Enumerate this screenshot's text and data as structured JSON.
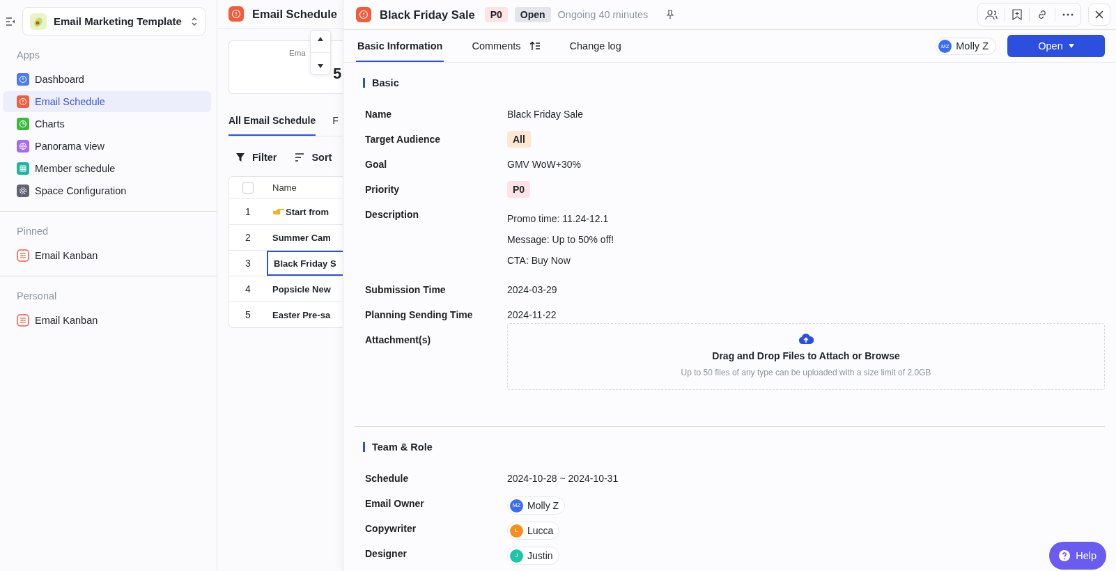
{
  "sidebar": {
    "workspace": "Email Marketing Template",
    "sections": [
      {
        "title": "Apps",
        "items": [
          {
            "label": "Dashboard",
            "kind": "info",
            "color": "#4b7bf5",
            "selected": false
          },
          {
            "label": "Email Schedule",
            "kind": "info",
            "color": "#f25c3c",
            "selected": true
          },
          {
            "label": "Charts",
            "kind": "chart",
            "color": "#3cb93c",
            "selected": false
          },
          {
            "label": "Panorama view",
            "kind": "globe",
            "color": "#a56cf0",
            "selected": false
          },
          {
            "label": "Member schedule",
            "kind": "grid",
            "color": "#1fb5a0",
            "selected": false
          },
          {
            "label": "Space Configuration",
            "kind": "gear",
            "color": "#5f6270",
            "selected": false
          }
        ]
      },
      {
        "title": "Pinned",
        "items": [
          {
            "label": "Email Kanban",
            "kind": "list",
            "color": "#f4816b",
            "selected": false
          }
        ]
      },
      {
        "title": "Personal",
        "items": [
          {
            "label": "Email Kanban",
            "kind": "list",
            "color": "#f4816b",
            "selected": false
          }
        ]
      }
    ]
  },
  "view": {
    "title": "Email Schedule",
    "card": {
      "label": "Ema",
      "value": "5"
    },
    "tabs": [
      {
        "label": "All Email Schedule",
        "selected": true
      },
      {
        "label": "F",
        "selected": false
      }
    ],
    "toolbar": [
      {
        "label": "Filter",
        "kind": "filter"
      },
      {
        "label": "Sort",
        "kind": "sort"
      }
    ],
    "table": {
      "columns": [
        "Name"
      ],
      "all_checked": false,
      "rows": [
        {
          "number": "1",
          "name": "Start from",
          "pointer": true,
          "selected": false
        },
        {
          "number": "2",
          "name": "Summer Cam",
          "pointer": false,
          "selected": false
        },
        {
          "number": "3",
          "name": "Black Friday S",
          "pointer": false,
          "selected": true
        },
        {
          "number": "4",
          "name": "Popsicle New",
          "pointer": false,
          "selected": false
        },
        {
          "number": "5",
          "name": "Easter Pre-sa",
          "pointer": false,
          "selected": false
        }
      ]
    }
  },
  "record": {
    "title": "Black Friday Sale",
    "tags": [
      {
        "label": "P0",
        "color": "#fde3e6"
      },
      {
        "label": "Open",
        "color": "#e3e5ea"
      }
    ],
    "status_text": "Ongoing 40 minutes",
    "tabs": [
      {
        "label": "Basic Information",
        "selected": true,
        "sort_icon": false
      },
      {
        "label": "Comments",
        "selected": false,
        "sort_icon": true
      },
      {
        "label": "Change log",
        "selected": false,
        "sort_icon": false
      }
    ],
    "assignee": {
      "initials": "MZ",
      "name": "Molly Z",
      "color": "#3b6cf6"
    },
    "status_button": "Open",
    "sections": [
      {
        "title": "Basic",
        "fields": [
          {
            "label": "Name",
            "kind": "text",
            "value": "Black Friday Sale"
          },
          {
            "label": "Target Audience",
            "kind": "tag",
            "value": "All",
            "color": "#fde7cf"
          },
          {
            "label": "Goal",
            "kind": "text",
            "value": "GMV WoW+30%"
          },
          {
            "label": "Priority",
            "kind": "tag",
            "value": "P0",
            "color": "#fde3e6"
          },
          {
            "label": "Description",
            "kind": "lines",
            "lines": [
              "Promo time: 11.24-12.1",
              "Message: Up to 50% off!",
              "CTA: Buy Now"
            ]
          },
          {
            "label": "Submission Time",
            "kind": "text",
            "value": "2024-03-29"
          },
          {
            "label": "Planning Sending Time",
            "kind": "text",
            "value": "2024-11-22"
          },
          {
            "label": "Attachment(s)",
            "kind": "upload",
            "title": "Drag and Drop Files to Attach or Browse",
            "hint": "Up to 50 files of any type can be uploaded with a size limit of 2.0GB"
          }
        ]
      },
      {
        "title": "Team & Role",
        "fields": [
          {
            "label": "Schedule",
            "kind": "text",
            "value": "2024-10-28 ~ 2024-10-31"
          },
          {
            "label": "Email Owner",
            "kind": "person",
            "initials": "MZ",
            "value": "Molly Z",
            "color": "#3b6cf6"
          },
          {
            "label": "Copywriter",
            "kind": "person",
            "initials": "L",
            "value": "Lucca",
            "color": "#f5901e"
          },
          {
            "label": "Designer",
            "kind": "person",
            "initials": "J",
            "value": "Justin",
            "color": "#1cc6a6"
          }
        ]
      }
    ]
  },
  "help": "Help"
}
